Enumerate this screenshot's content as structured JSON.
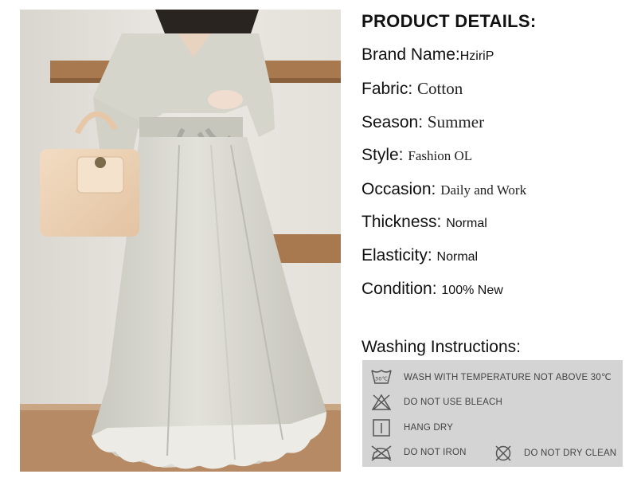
{
  "heading": "PRODUCT DETAILS:",
  "details": [
    {
      "label": "Brand Name:",
      "value": "HziriP"
    },
    {
      "label": "Fabric: ",
      "value": "Cotton"
    },
    {
      "label": "Season: ",
      "value": "Summer"
    },
    {
      "label": "Style: ",
      "value": "Fashion OL"
    },
    {
      "label": "Occasion: ",
      "value": "Daily and Work"
    },
    {
      "label": "Thickness: ",
      "value": "Normal"
    },
    {
      "label": "Elasticity: ",
      "value": "Normal"
    },
    {
      "label": "Condition: ",
      "value": "100% New"
    }
  ],
  "washing": {
    "heading": "Washing Instructions:",
    "items": [
      {
        "icon": "wash-30-icon",
        "icon_text": "30℃",
        "text": "WASH WITH TEMPERATURE NOT ABOVE 30℃"
      },
      {
        "icon": "no-bleach-icon",
        "text": "DO NOT USE BLEACH"
      },
      {
        "icon": "hang-dry-icon",
        "text": "HANG DRY"
      },
      {
        "icon": "no-iron-icon",
        "text": "DO NOT IRON"
      },
      {
        "icon": "no-dry-clean-icon",
        "text": "DO NOT DRY CLEAN"
      }
    ]
  }
}
